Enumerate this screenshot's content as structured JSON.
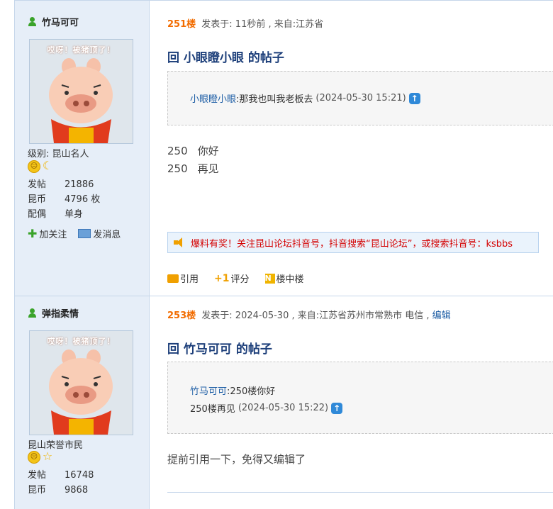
{
  "posts": [
    {
      "user": {
        "name": "竹马可可",
        "level": "级别: 昆山名人",
        "avatar_caption": "哎呀！被猪顶了！",
        "stats": [
          {
            "k": "发帖",
            "v": "21886"
          },
          {
            "k": "昆币",
            "v": "4796 枚"
          },
          {
            "k": "配偶",
            "v": "单身"
          }
        ],
        "follow": "加关注",
        "message": "发消息"
      },
      "floor": "251楼",
      "meta": "发表于: 11秒前 , 来自:江苏省",
      "title": "回 小眼瞪小眼 的帖子",
      "quote": {
        "user": "小眼瞪小眼",
        "text": ":那我也叫我老板去",
        "time": "(2024-05-30 15:21)"
      },
      "body": [
        {
          "num": "250",
          "text": "你好"
        },
        {
          "num": "250",
          "text": "再见"
        }
      ],
      "notice": "爆料有奖！关注昆山论坛抖音号，抖音搜索“昆山论坛”，或搜索抖音号：ksbbs",
      "toolbar": {
        "quote": "引用",
        "rate": "评分",
        "floor_link": "楼中楼"
      }
    },
    {
      "user": {
        "name": "弹指柔情",
        "level": "昆山荣誉市民",
        "avatar_caption": "哎呀！被猪顶了！",
        "stats": [
          {
            "k": "发帖",
            "v": "16748"
          },
          {
            "k": "昆币",
            "v": "9868"
          }
        ]
      },
      "floor": "253楼",
      "meta": "发表于: 2024-05-30 , 来自:江苏省苏州市常熟市 电信 ,",
      "edit": "编辑",
      "title": "回 竹马可可 的帖子",
      "quote": {
        "user": "竹马可可",
        "text": ":250楼你好",
        "line2": "250楼再见",
        "time": "(2024-05-30 15:22)"
      },
      "body_text": "提前引用一下，免得又编辑了"
    }
  ],
  "colors": {
    "sidebar": "#e6eef8",
    "floor": "#f26c00",
    "title": "#1d3f7a",
    "link": "#1f5fa6",
    "notice": "#d40000"
  }
}
